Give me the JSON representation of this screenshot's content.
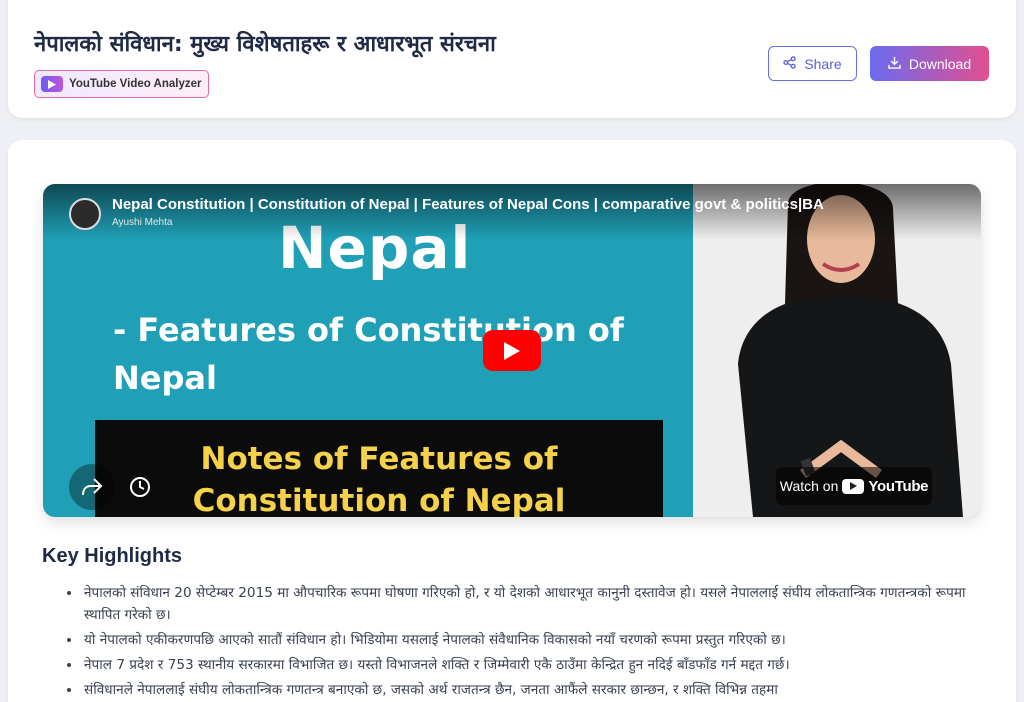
{
  "header": {
    "title": "नेपालको संविधान: मुख्य विशेषताहरू र आधारभूत संरचना",
    "badge_label": "YouTube Video Analyzer",
    "share_label": "Share",
    "download_label": "Download"
  },
  "video": {
    "title": "Nepal Constitution | Constitution of Nepal | Features of Nepal Cons | comparative govt & politics|BA",
    "channel": "Ayushi Mehta",
    "slide_heading": "Nepal",
    "slide_bullet": "- Features of Constitution of Nepal",
    "slide_notes": "Notes of Features of Constitution of Nepal",
    "watch_on_label": "Watch on",
    "youtube_word": "YouTube"
  },
  "highlights": {
    "heading": "Key Highlights",
    "items": [
      "नेपालको संविधान 20 सेप्टेम्बर 2015 मा औपचारिक रूपमा घोषणा गरिएको हो, र यो देशको आधारभूत कानुनी दस्तावेज हो। यसले नेपाललाई संघीय लोकतान्त्रिक गणतन्त्रको रूपमा स्थापित गरेको छ।",
      "यो नेपालको एकीकरणपछि आएको सातौं संविधान हो। भिडियोमा यसलाई नेपालको संवैधानिक विकासको नयाँ चरणको रूपमा प्रस्तुत गरिएको छ।",
      "नेपाल 7 प्रदेश र 753 स्थानीय सरकारमा विभाजित छ। यस्तो विभाजनले शक्ति र जिम्मेवारी एकै ठाउँमा केन्द्रित हुन नदिई बाँडफाँड गर्न मद्दत गर्छ।",
      "संविधानले नेपाललाई संघीय लोकतान्त्रिक गणतन्त्र बनाएको छ, जसको अर्थ राजतन्त्र छैन, जनता आफैंले सरकार छान्छन, र शक्ति विभिन्न तहमा"
    ]
  },
  "colors": {
    "accent": "#6a6bf0",
    "accent_pink": "#e34f8f",
    "video_bg": "#1fa0b6",
    "play_red": "#ff0000",
    "notes_yellow": "#f6d24a"
  },
  "icons": {
    "badge": "play-icon",
    "share": "share-icon",
    "download": "download-icon",
    "video_share": "share-arrow-icon",
    "watch_later": "clock-icon"
  }
}
